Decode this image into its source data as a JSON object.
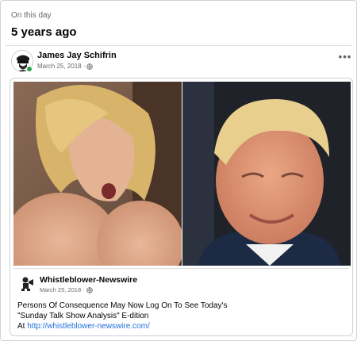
{
  "memory": {
    "label": "On this day",
    "title": "5 years ago"
  },
  "post": {
    "author": "James Jay Schifrin",
    "date": "March 25, 2018 ·",
    "more_label": "•••",
    "privacy_icon": "globe-icon"
  },
  "shared": {
    "page_name": "Whistleblower-Newswire",
    "date": "March 25, 2018 ·",
    "text_line1": "Persons Of Consequence May Now Log On To See Today's",
    "text_line2": "\"Sunday Talk Show Analysis\" E-dition",
    "text_prefix": "At ",
    "link": "http://whistleblower-newswire.com/"
  },
  "colors": {
    "link": "#216fdb",
    "online": "#31a24c",
    "muted": "#65676b"
  }
}
